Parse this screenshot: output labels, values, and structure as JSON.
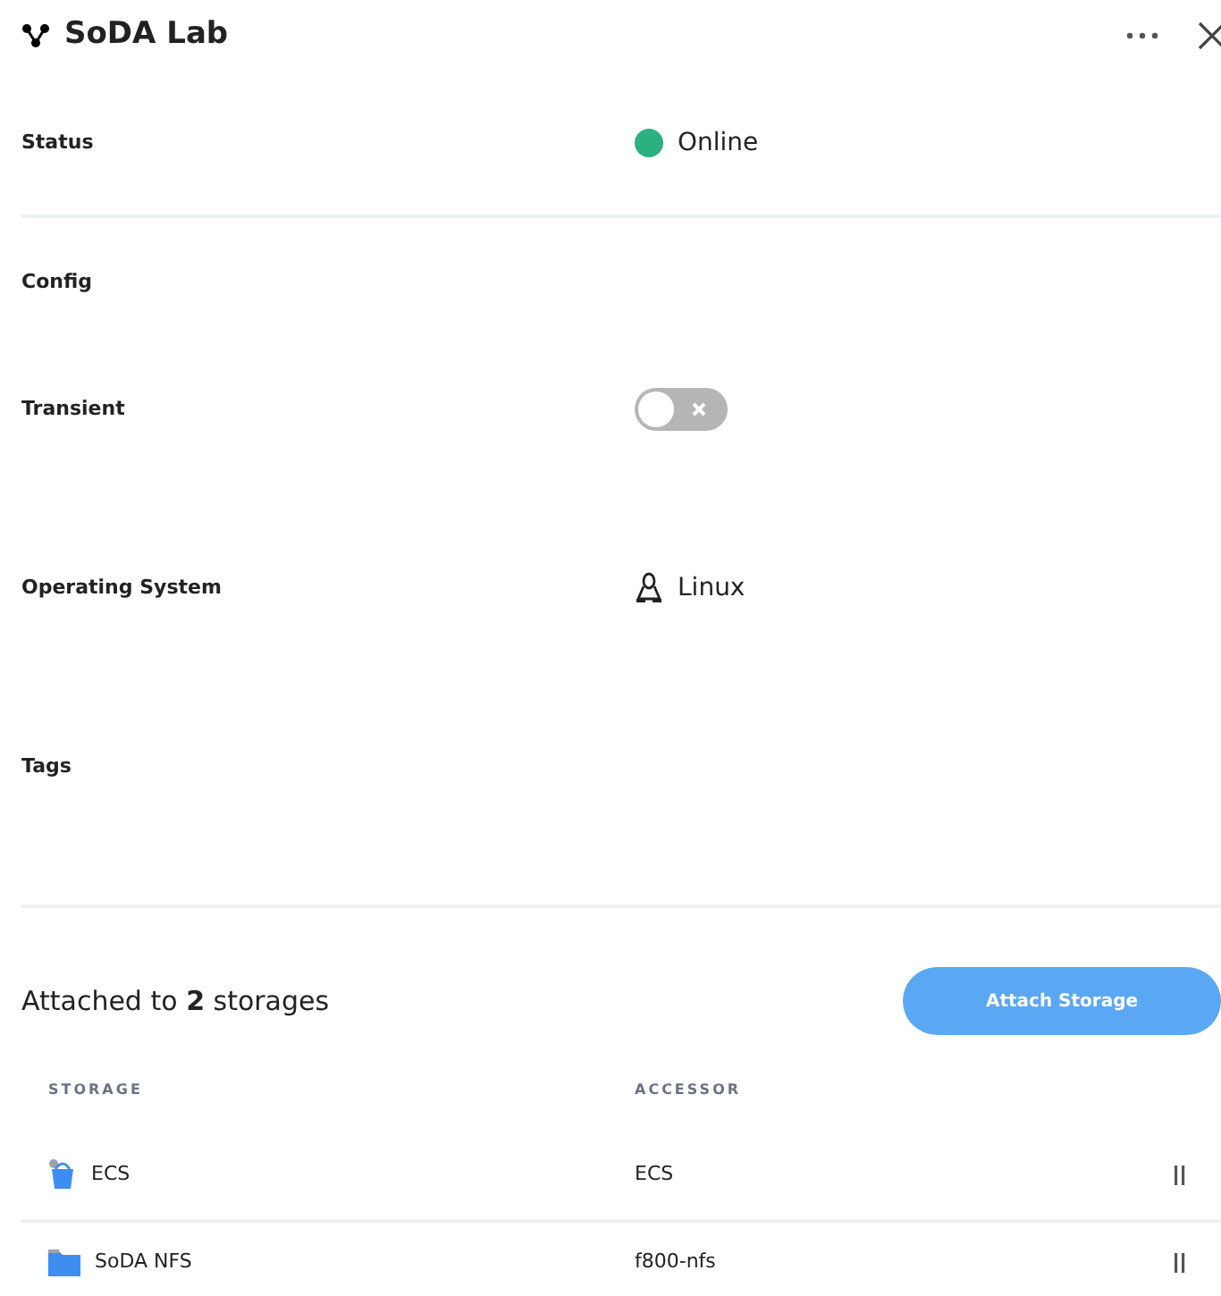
{
  "title": "SoDA Lab",
  "status": {
    "label": "Status",
    "value": "Online",
    "color": "#2bb07f"
  },
  "config": {
    "heading": "Config",
    "transient": {
      "label": "Transient",
      "on": false
    },
    "os": {
      "label": "Operating System",
      "value": "Linux"
    },
    "tags": {
      "label": "Tags"
    }
  },
  "storages": {
    "summary": "Attached to **2** storages",
    "button": "Attach Storage",
    "columns": [
      "STORAGE",
      "ACCESSOR"
    ],
    "rows": [
      {
        "kind": "bucket",
        "name": "ECS",
        "accessor": "ECS"
      },
      {
        "kind": "folder",
        "name": "SoDA NFS",
        "accessor": "f800-nfs"
      }
    ]
  }
}
